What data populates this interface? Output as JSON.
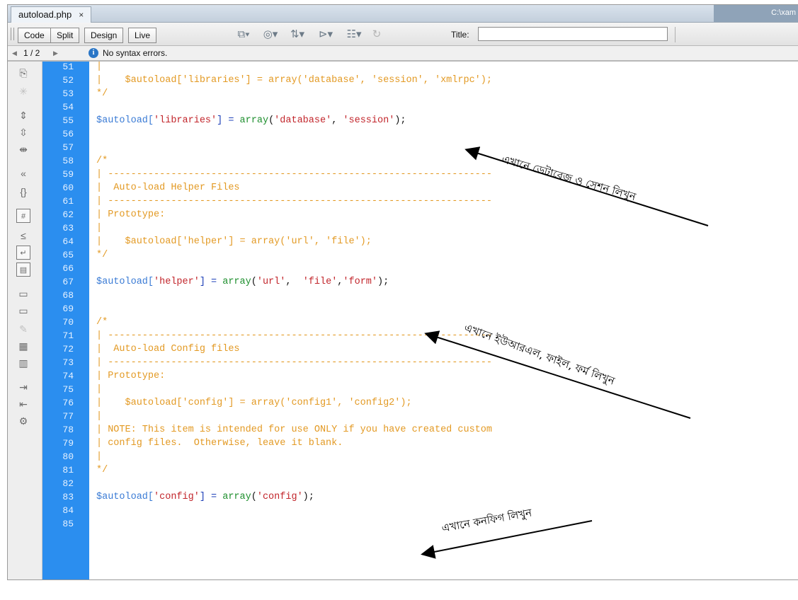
{
  "tab": {
    "filename": "autoload.php",
    "close": "×",
    "path": "C:\\xam"
  },
  "toolbar": {
    "views": [
      "Code",
      "Split",
      "Design",
      "Live"
    ],
    "title_label": "Title:",
    "title_value": "",
    "icons": [
      "multiscreen-icon",
      "preview-browser-icon",
      "file-management-icon",
      "check-page-icon",
      "visual-aids-icon",
      "refresh-icon"
    ]
  },
  "status": {
    "page": "1 / 2",
    "message": "No syntax errors."
  },
  "line_numbers": [
    "51",
    "52",
    "53",
    "54",
    "55",
    "56",
    "57",
    "58",
    "59",
    "60",
    "61",
    "62",
    "63",
    "64",
    "65",
    "66",
    "67",
    "68",
    "69",
    "70",
    "71",
    "72",
    "73",
    "74",
    "75",
    "76",
    "77",
    "78",
    "79",
    "80",
    "81",
    "82",
    "83",
    "84",
    "85"
  ],
  "code": {
    "l51": "|",
    "l52": "|    $autoload['libraries'] = array('database', 'session', 'xmlrpc');",
    "l53": "*/",
    "l55_var": "$autoload[",
    "l55_key": "'libraries'",
    "l55_b": "] = ",
    "l55_fn": "array",
    "l55_args_open": "(",
    "l55_a1": "'database'",
    "l55_sep": ", ",
    "l55_a2": "'session'",
    "l55_close": ");",
    "l58": "/*",
    "l59": "| -------------------------------------------------------------------",
    "l60": "|  Auto-load Helper Files",
    "l61": "| -------------------------------------------------------------------",
    "l62": "| Prototype:",
    "l63": "|",
    "l64": "|    $autoload['helper'] = array('url', 'file');",
    "l65": "*/",
    "l67_var": "$autoload[",
    "l67_key": "'helper'",
    "l67_b": "] = ",
    "l67_fn": "array",
    "l67_open": "(",
    "l67_a1": "'url'",
    "l67_sep1": ",  ",
    "l67_a2": "'file'",
    "l67_sep2": ",",
    "l67_a3": "'form'",
    "l67_close": ");",
    "l70": "/*",
    "l71": "| -------------------------------------------------------------------",
    "l72": "|  Auto-load Config files",
    "l73": "| -------------------------------------------------------------------",
    "l74": "| Prototype:",
    "l75": "|",
    "l76": "|    $autoload['config'] = array('config1', 'config2');",
    "l77": "|",
    "l78": "| NOTE: This item is intended for use ONLY if you have created custom",
    "l79": "| config files.  Otherwise, leave it blank.",
    "l80": "|",
    "l81": "*/",
    "l83_var": "$autoload[",
    "l83_key": "'config'",
    "l83_b": "] = ",
    "l83_fn": "array",
    "l83_open": "(",
    "l83_a1": "'config'",
    "l83_close": ");"
  },
  "annotations": {
    "database_session": "এখানে ডেটাবেজ ও সেশন লিখুন",
    "helpers": "এখানে ইউআরএল, ফাইল, ফর্ম লিখুন",
    "config": "এখানে কনফিগ লিখুন"
  },
  "colors": {
    "gutter": "#2b8eef",
    "comment": "#e39a24",
    "string": "#c2252b",
    "variable": "#3a7bd5",
    "function": "#1e8f2e"
  }
}
